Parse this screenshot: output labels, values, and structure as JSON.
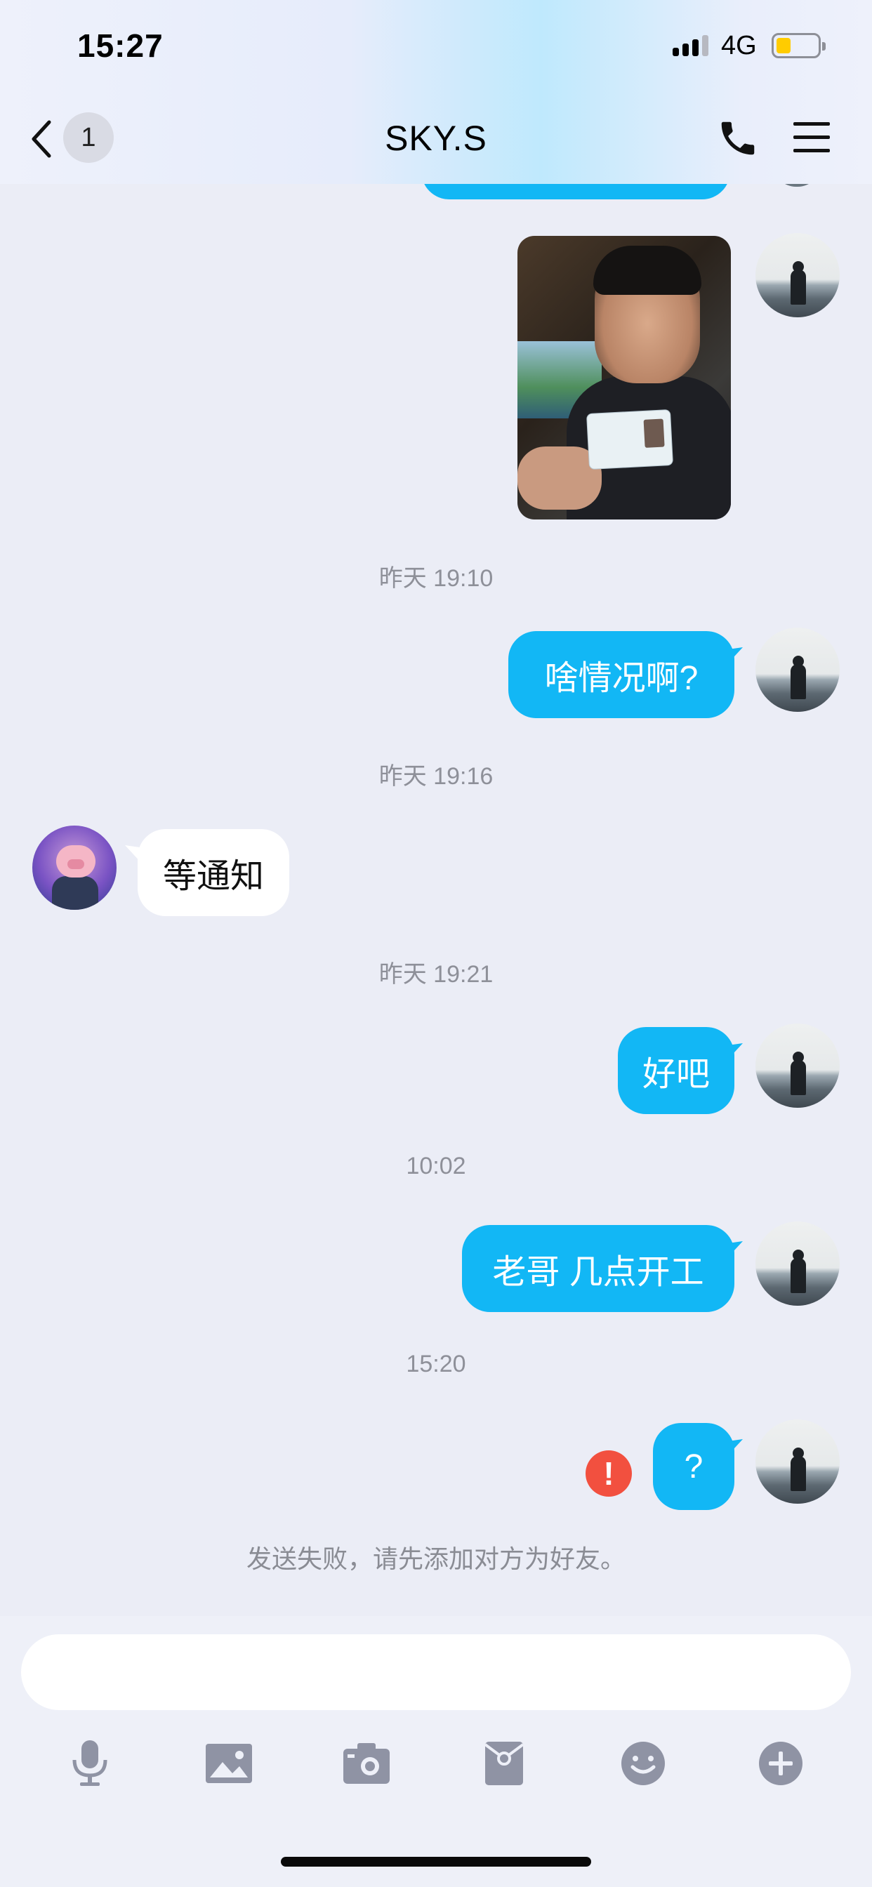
{
  "status_bar": {
    "time": "15:27",
    "network": "4G"
  },
  "header": {
    "back_count": "1",
    "title": "SKY.S"
  },
  "messages": {
    "ts1": "昨天 19:10",
    "msg1": "啥情况啊?",
    "ts2": "昨天 19:16",
    "msg2": "等通知",
    "ts3": "昨天 19:21",
    "msg3": "好吧",
    "ts4": "10:02",
    "msg4": "老哥 几点开工",
    "ts5": "15:20",
    "msg5": "?",
    "fail_note": "发送失败，请先添加对方为好友。"
  },
  "input": {
    "value": "",
    "placeholder": ""
  },
  "toolbar": [
    "mic-icon",
    "image-icon",
    "camera-icon",
    "red-packet-icon",
    "emoji-icon",
    "plus-icon"
  ],
  "colors": {
    "outgoing_bubble": "#12b7f5",
    "incoming_bubble": "#ffffff",
    "error": "#f2503f",
    "background": "#ebedf6"
  }
}
